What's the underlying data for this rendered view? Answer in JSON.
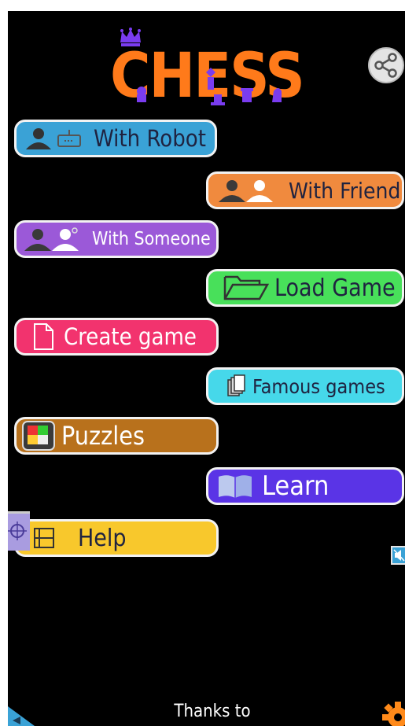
{
  "app": {
    "title": "CHESS"
  },
  "menu": {
    "with_robot": "With Robot",
    "with_friend": "With Friend",
    "with_someone": "With Someone",
    "load_game": "Load Game",
    "create_game": "Create game",
    "famous_games": "Famous games",
    "puzzles": "Puzzles",
    "learn": "Learn",
    "help": "Help"
  },
  "footer": {
    "thanks": "Thanks to"
  },
  "colors": {
    "logo": "#ff7a1a",
    "crown": "#7a3cf0",
    "with_robot": "#3aa2d6",
    "with_friend": "#f08a3e",
    "with_someone": "#9b59d8",
    "load_game": "#48e05a",
    "create_game": "#f2336e",
    "famous_games": "#46d8ea",
    "puzzles": "#b8711c",
    "learn": "#5a34e6",
    "help": "#f8c82c"
  },
  "icons": [
    "crown-icon",
    "chess-pieces-icon",
    "share-icon",
    "user-icon",
    "robot-icon",
    "friend-icon",
    "someone-icon",
    "folder-icon",
    "document-icon",
    "cards-icon",
    "puzzle-icon",
    "book-icon",
    "film-icon",
    "target-icon",
    "mute-icon",
    "back-arrow-icon",
    "gear-icon"
  ]
}
